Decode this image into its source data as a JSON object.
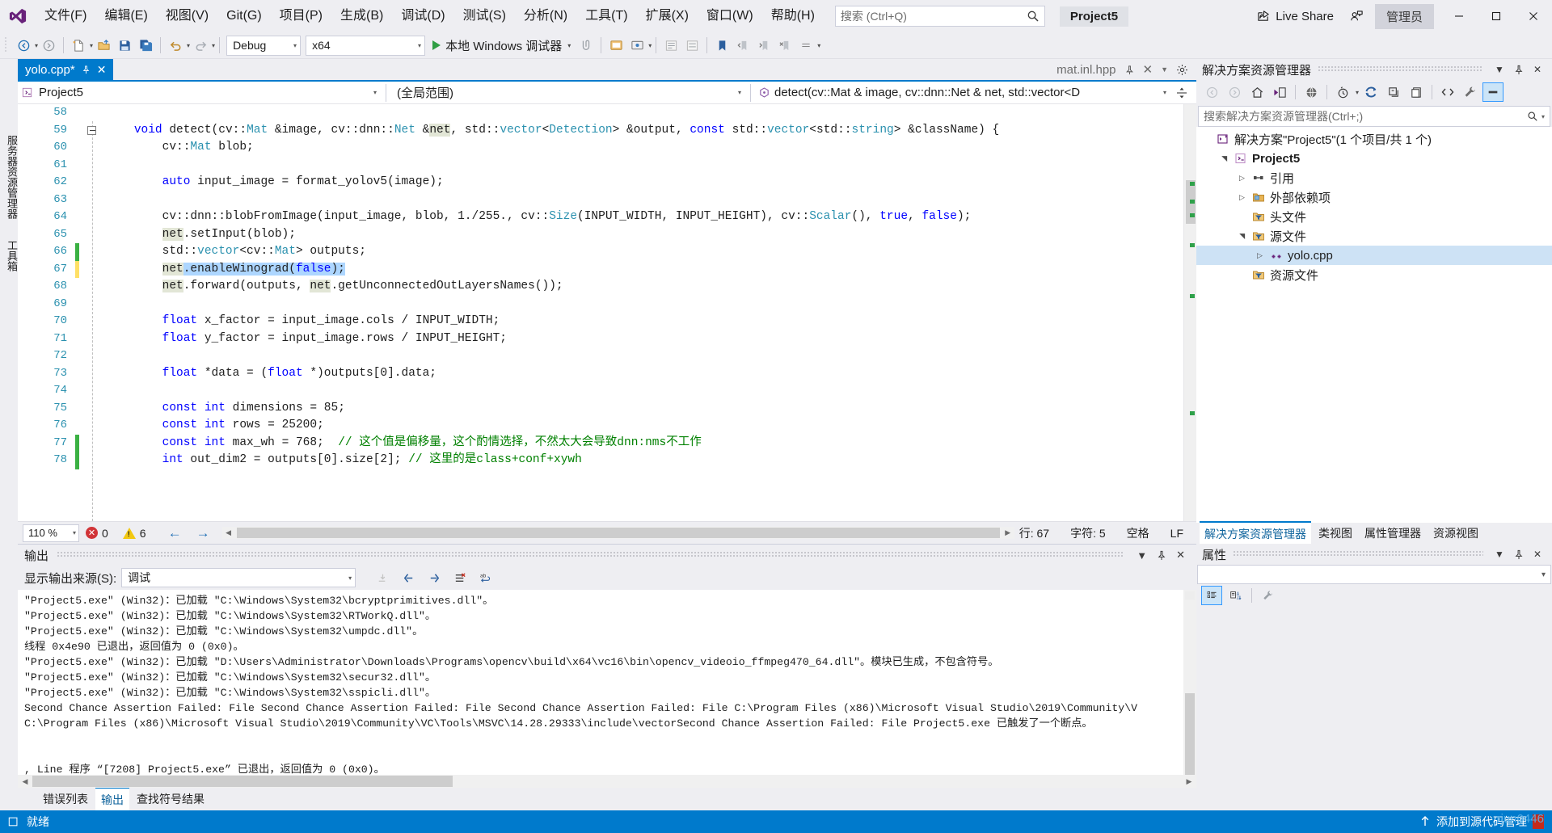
{
  "app": {
    "title": "Visual Studio",
    "project_chip": "Project5",
    "live_share": "Live Share",
    "admin_chip": "管理员"
  },
  "menu": {
    "items": [
      {
        "label": "文件(F)"
      },
      {
        "label": "编辑(E)"
      },
      {
        "label": "视图(V)"
      },
      {
        "label": "Git(G)"
      },
      {
        "label": "项目(P)"
      },
      {
        "label": "生成(B)"
      },
      {
        "label": "调试(D)"
      },
      {
        "label": "测试(S)"
      },
      {
        "label": "分析(N)"
      },
      {
        "label": "工具(T)"
      },
      {
        "label": "扩展(X)"
      },
      {
        "label": "窗口(W)"
      },
      {
        "label": "帮助(H)"
      }
    ]
  },
  "search": {
    "placeholder": "搜索 (Ctrl+Q)",
    "icon": "search-icon"
  },
  "window_controls": {
    "minimize": "最小化",
    "maximize": "最大化",
    "close": "关闭"
  },
  "toolbar": {
    "config": "Debug",
    "platform": "x64",
    "run_label": "本地 Windows 调试器",
    "icons": [
      "back-icon",
      "forward-icon",
      "new-item-icon",
      "open-file-icon",
      "save-icon",
      "save-all-icon",
      "undo-icon",
      "redo-icon",
      "attach-icon",
      "preview-icon",
      "window-layout-icon",
      "align-left-icon",
      "align-right-icon",
      "bookmark-icon",
      "indent-icon",
      "outdent-icon"
    ]
  },
  "left_rail": {
    "items": [
      "服务器资源管理器",
      "工具箱"
    ]
  },
  "editor": {
    "tab": {
      "label": "yolo.cpp*",
      "pin": "pin-icon",
      "close": "close-icon"
    },
    "right_tab": {
      "label": "mat.inl.hpp",
      "pin": "pin-icon",
      "close": "close-icon",
      "dropdown": "chevron-down-icon",
      "settings": "gear-icon"
    },
    "navbar": {
      "project": "Project5",
      "scope": "(全局范围)",
      "member": "detect(cv::Mat & image, cv::dnn::Net & net, std::vector<D"
    },
    "first_line_number": 58,
    "lines": [
      {
        "n": 58,
        "tokens": [],
        "change": "",
        "fold": ""
      },
      {
        "n": 59,
        "fold": "minus",
        "change": "",
        "tokens": [
          {
            "t": "    ",
            "c": ""
          },
          {
            "t": "void",
            "c": "kw"
          },
          {
            "t": " detect(",
            "c": ""
          },
          {
            "t": "cv",
            "c": ""
          },
          {
            "t": "::",
            "c": ""
          },
          {
            "t": "Mat",
            "c": "typ"
          },
          {
            "t": " &image, ",
            "c": ""
          },
          {
            "t": "cv::dnn::",
            "c": ""
          },
          {
            "t": "Net",
            "c": "typ"
          },
          {
            "t": " &",
            "c": ""
          },
          {
            "t": "net",
            "c": "ref"
          },
          {
            "t": ", ",
            "c": ""
          },
          {
            "t": "std",
            "c": ""
          },
          {
            "t": "::",
            "c": ""
          },
          {
            "t": "vector",
            "c": "typ"
          },
          {
            "t": "<",
            "c": ""
          },
          {
            "t": "Detection",
            "c": "typ"
          },
          {
            "t": "> &output, ",
            "c": ""
          },
          {
            "t": "const",
            "c": "kw"
          },
          {
            "t": " ",
            "c": ""
          },
          {
            "t": "std",
            "c": ""
          },
          {
            "t": "::",
            "c": ""
          },
          {
            "t": "vector",
            "c": "typ"
          },
          {
            "t": "<",
            "c": ""
          },
          {
            "t": "std",
            "c": ""
          },
          {
            "t": "::",
            "c": ""
          },
          {
            "t": "string",
            "c": "typ"
          },
          {
            "t": "> &className) {",
            "c": ""
          }
        ]
      },
      {
        "n": 60,
        "change": "",
        "tokens": [
          {
            "t": "        cv::",
            "c": ""
          },
          {
            "t": "Mat",
            "c": "typ"
          },
          {
            "t": " blob;",
            "c": ""
          }
        ]
      },
      {
        "n": 61,
        "change": "",
        "tokens": []
      },
      {
        "n": 62,
        "change": "",
        "tokens": [
          {
            "t": "        ",
            "c": ""
          },
          {
            "t": "auto",
            "c": "kw"
          },
          {
            "t": " input_image = format_yolov5(image);",
            "c": ""
          }
        ]
      },
      {
        "n": 63,
        "change": "",
        "tokens": []
      },
      {
        "n": 64,
        "change": "",
        "tokens": [
          {
            "t": "        cv::dnn::blobFromImage(input_image, blob, ",
            "c": ""
          },
          {
            "t": "1.",
            "c": "num"
          },
          {
            "t": "/",
            "c": ""
          },
          {
            "t": "255.",
            "c": "num"
          },
          {
            "t": ", cv::",
            "c": ""
          },
          {
            "t": "Size",
            "c": "typ"
          },
          {
            "t": "(INPUT_WIDTH, INPUT_HEIGHT), cv::",
            "c": ""
          },
          {
            "t": "Scalar",
            "c": "typ"
          },
          {
            "t": "(), ",
            "c": ""
          },
          {
            "t": "true",
            "c": "kw"
          },
          {
            "t": ", ",
            "c": ""
          },
          {
            "t": "false",
            "c": "kw"
          },
          {
            "t": ");",
            "c": ""
          }
        ]
      },
      {
        "n": 65,
        "change": "",
        "tokens": [
          {
            "t": "net",
            "c": "ref"
          },
          {
            "t": ".setInput(blob);",
            "c": ""
          }
        ],
        "indent": 8
      },
      {
        "n": 66,
        "change": "green",
        "tokens": [
          {
            "t": "        std::",
            "c": ""
          },
          {
            "t": "vector",
            "c": "typ"
          },
          {
            "t": "<cv::",
            "c": ""
          },
          {
            "t": "Mat",
            "c": "typ"
          },
          {
            "t": "> outputs;",
            "c": ""
          }
        ]
      },
      {
        "n": 67,
        "change": "yellow",
        "selected": true,
        "tokens": [
          {
            "t": "net",
            "c": "ref"
          },
          {
            "t": ".enableWinograd(",
            "c": ""
          },
          {
            "t": "false",
            "c": "kw"
          },
          {
            "t": ");",
            "c": ""
          }
        ],
        "indent": 8
      },
      {
        "n": 68,
        "change": "",
        "tokens": [
          {
            "t": "net",
            "c": "ref"
          },
          {
            "t": ".forward(outputs, ",
            "c": ""
          },
          {
            "t": "net",
            "c": "ref"
          },
          {
            "t": ".getUnconnectedOutLayersNames());",
            "c": ""
          }
        ],
        "indent": 8
      },
      {
        "n": 69,
        "change": "",
        "tokens": []
      },
      {
        "n": 70,
        "change": "",
        "tokens": [
          {
            "t": "        ",
            "c": ""
          },
          {
            "t": "float",
            "c": "kw"
          },
          {
            "t": " x_factor = input_image.cols / INPUT_WIDTH;",
            "c": ""
          }
        ]
      },
      {
        "n": 71,
        "change": "",
        "tokens": [
          {
            "t": "        ",
            "c": ""
          },
          {
            "t": "float",
            "c": "kw"
          },
          {
            "t": " y_factor = input_image.rows / INPUT_HEIGHT;",
            "c": ""
          }
        ]
      },
      {
        "n": 72,
        "change": "",
        "tokens": []
      },
      {
        "n": 73,
        "change": "",
        "tokens": [
          {
            "t": "        ",
            "c": ""
          },
          {
            "t": "float",
            "c": "kw"
          },
          {
            "t": " *data = (",
            "c": ""
          },
          {
            "t": "float",
            "c": "kw"
          },
          {
            "t": " *)outputs[",
            "c": ""
          },
          {
            "t": "0",
            "c": "num"
          },
          {
            "t": "].data;",
            "c": ""
          }
        ]
      },
      {
        "n": 74,
        "change": "",
        "tokens": []
      },
      {
        "n": 75,
        "change": "",
        "tokens": [
          {
            "t": "        ",
            "c": ""
          },
          {
            "t": "const",
            "c": "kw"
          },
          {
            "t": " ",
            "c": ""
          },
          {
            "t": "int",
            "c": "kw"
          },
          {
            "t": " dimensions = ",
            "c": ""
          },
          {
            "t": "85",
            "c": "num"
          },
          {
            "t": ";",
            "c": ""
          }
        ]
      },
      {
        "n": 76,
        "change": "",
        "tokens": [
          {
            "t": "        ",
            "c": ""
          },
          {
            "t": "const",
            "c": "kw"
          },
          {
            "t": " ",
            "c": ""
          },
          {
            "t": "int",
            "c": "kw"
          },
          {
            "t": " rows = ",
            "c": ""
          },
          {
            "t": "25200",
            "c": "num"
          },
          {
            "t": ";",
            "c": ""
          }
        ]
      },
      {
        "n": 77,
        "change": "green",
        "tokens": [
          {
            "t": "        ",
            "c": ""
          },
          {
            "t": "const",
            "c": "kw"
          },
          {
            "t": " ",
            "c": ""
          },
          {
            "t": "int",
            "c": "kw"
          },
          {
            "t": " max_wh = ",
            "c": ""
          },
          {
            "t": "768",
            "c": "num"
          },
          {
            "t": ";  ",
            "c": ""
          },
          {
            "t": "// 这个值是偏移量，这个酌情选择，不然太大会导致dnn:nms不工作",
            "c": "cmt"
          }
        ]
      },
      {
        "n": 78,
        "change": "green",
        "tokens": [
          {
            "t": "        ",
            "c": ""
          },
          {
            "t": "int",
            "c": "kw"
          },
          {
            "t": " out_dim2 = outputs[",
            "c": ""
          },
          {
            "t": "0",
            "c": "num"
          },
          {
            "t": "].size[",
            "c": ""
          },
          {
            "t": "2",
            "c": "num"
          },
          {
            "t": "]; ",
            "c": ""
          },
          {
            "t": "// 这里的是class+conf+xywh",
            "c": "cmt"
          }
        ]
      }
    ],
    "status": {
      "zoom": "110 %",
      "errors": "0",
      "warnings": "6",
      "line_label": "行: 67",
      "col_label": "字符: 5",
      "insert_mode": "空格",
      "eol": "LF"
    }
  },
  "output_panel": {
    "title": "输出",
    "source_label": "显示输出来源(S):",
    "source_value": "调试",
    "toolbar_icons": [
      "jump-to-icon",
      "previous-message-icon",
      "next-message-icon",
      "clear-all-icon",
      "word-wrap-icon"
    ],
    "lines": [
      "\"Project5.exe\" (Win32)：已加载 \"C:\\Windows\\System32\\bcryptprimitives.dll\"。",
      "\"Project5.exe\" (Win32)：已加载 \"C:\\Windows\\System32\\RTWorkQ.dll\"。",
      "\"Project5.exe\" (Win32)：已加载 \"C:\\Windows\\System32\\umpdc.dll\"。",
      "线程 0x4e90 已退出，返回值为 0 (0x0)。",
      "\"Project5.exe\" (Win32)：已加载 \"D:\\Users\\Administrator\\Downloads\\Programs\\opencv\\build\\x64\\vc16\\bin\\opencv_videoio_ffmpeg470_64.dll\"。模块已生成，不包含符号。",
      "\"Project5.exe\" (Win32)：已加载 \"C:\\Windows\\System32\\secur32.dll\"。",
      "\"Project5.exe\" (Win32)：已加载 \"C:\\Windows\\System32\\sspicli.dll\"。",
      "Second Chance Assertion Failed: File Second Chance Assertion Failed: File Second Chance Assertion Failed: File C:\\Program Files (x86)\\Microsoft Visual Studio\\2019\\Community\\V",
      "C:\\Program Files (x86)\\Microsoft Visual Studio\\2019\\Community\\VC\\Tools\\MSVC\\14.28.29333\\include\\vectorSecond Chance Assertion Failed: File Project5.exe 已触发了一个断点。",
      "",
      "",
      ", Line 程序 “[7208] Project5.exe” 已退出，返回值为 0 (0x0)。"
    ],
    "tabs": [
      {
        "label": "错误列表",
        "active": false
      },
      {
        "label": "输出",
        "active": true
      },
      {
        "label": "查找符号结果",
        "active": false
      }
    ]
  },
  "solution_explorer": {
    "title": "解决方案资源管理器",
    "search_placeholder": "搜索解决方案资源管理器(Ctrl+;)",
    "toolbar_icons": [
      "back-icon",
      "forward-icon",
      "home-icon",
      "solution-view-icon",
      "show-all-files-icon",
      "pending-changes-icon",
      "refresh-icon",
      "collapse-all-icon",
      "properties-page-icon",
      "view-code-icon",
      "properties-icon",
      "preview-selected-icon"
    ],
    "tree": [
      {
        "level": 0,
        "expander": "",
        "icon": "solution-icon",
        "label": "解决方案\"Project5\"(1 个项目/共 1 个)",
        "bold": false,
        "selected": false
      },
      {
        "level": 1,
        "expander": "expanded",
        "icon": "project-icon",
        "label": "Project5",
        "bold": true,
        "selected": false
      },
      {
        "level": 2,
        "expander": "collapsed",
        "icon": "references-icon",
        "label": "引用",
        "bold": false,
        "selected": false
      },
      {
        "level": 2,
        "expander": "collapsed",
        "icon": "folder-icon",
        "label": "外部依赖项",
        "bold": false,
        "selected": false
      },
      {
        "level": 2,
        "expander": "",
        "icon": "filter-folder-icon",
        "label": "头文件",
        "bold": false,
        "selected": false
      },
      {
        "level": 2,
        "expander": "expanded",
        "icon": "filter-folder-icon",
        "label": "源文件",
        "bold": false,
        "selected": false
      },
      {
        "level": 3,
        "expander": "collapsed",
        "icon": "cpp-file-icon",
        "label": "yolo.cpp",
        "bold": false,
        "selected": true
      },
      {
        "level": 2,
        "expander": "",
        "icon": "filter-folder-icon",
        "label": "资源文件",
        "bold": false,
        "selected": false
      }
    ],
    "tabs": [
      {
        "label": "解决方案资源管理器",
        "active": true
      },
      {
        "label": "类视图",
        "active": false
      },
      {
        "label": "属性管理器",
        "active": false
      },
      {
        "label": "资源视图",
        "active": false
      }
    ]
  },
  "properties_panel": {
    "title": "属性",
    "toolbar_icons": [
      "categorized-icon",
      "alphabetical-icon",
      "property-pages-icon"
    ]
  },
  "statusbar": {
    "state": "就绪",
    "add_to_source_control": "添加到源代码管理",
    "watermark": "rjun0446"
  },
  "colors": {
    "accent": "#007ACC",
    "chrome": "#EEEEF2",
    "editor_bg": "#FFFFFF",
    "selection": "#ADD6FF",
    "reference_highlight": "#E2E6D6",
    "line_number": "#2B91AF",
    "keyword": "#0000FF",
    "type": "#2B91AF",
    "comment": "#008000",
    "change_saved": "#3BB143",
    "change_unsaved": "#FFE066",
    "error": "#D13438",
    "warning": "#F2C811"
  }
}
